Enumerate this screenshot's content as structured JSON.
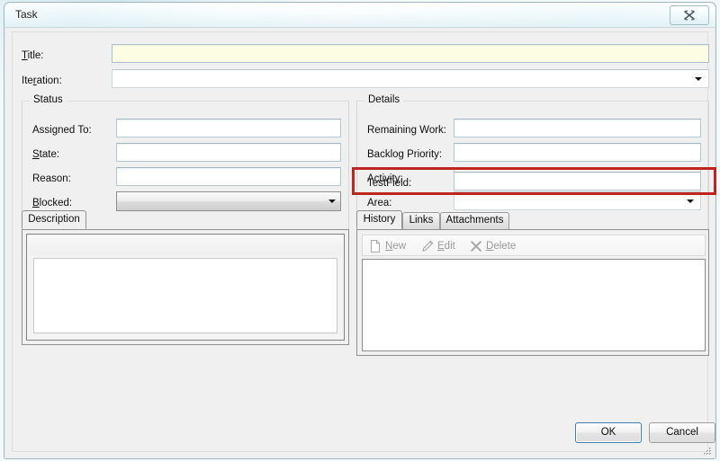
{
  "window": {
    "title": "Task",
    "close_label": "Close",
    "close_icon": "close-x-icon"
  },
  "top_fields": [
    {
      "label": "T",
      "label_accel": "T",
      "label_text": "Title:",
      "pre": "",
      "accel": "T",
      "post": "itle:",
      "value": "",
      "placeholder": "",
      "control": "textbox",
      "required": true
    },
    {
      "label_text": "Iteration:",
      "pre": "Ite",
      "accel": "r",
      "post": "ation:",
      "value": "",
      "placeholder": "",
      "control": "combobox-flat",
      "required": false
    }
  ],
  "status_group": {
    "title": "Status",
    "fields": [
      {
        "label_text": "Assigned To:",
        "pre": "Assi",
        "accel": "g",
        "post": "ned To:",
        "value": "",
        "control": "textbox"
      },
      {
        "label_text": "State:",
        "pre": "",
        "accel": "S",
        "post": "tate:",
        "value": "",
        "control": "textbox"
      },
      {
        "label_text": "Reason:",
        "pre": "Reason:",
        "accel": "",
        "post": "",
        "value": "",
        "control": "textbox"
      },
      {
        "label_text": "Blocked:",
        "pre": "",
        "accel": "B",
        "post": "locked:",
        "value": "",
        "control": "combobox-list"
      }
    ]
  },
  "details_group": {
    "title": "Details",
    "fields": [
      {
        "label_text": "Remaining Work:",
        "value": "",
        "control": "textbox"
      },
      {
        "label_text": "Backlog Priority:",
        "value": "",
        "control": "textbox"
      },
      {
        "label_text": "Activity:",
        "value": "",
        "control": "textbox"
      },
      {
        "label_text": "Area:",
        "value": "",
        "control": "combobox-flat"
      },
      {
        "label_text": "TestField:",
        "value": "",
        "control": "textbox",
        "highlighted": true
      }
    ]
  },
  "description_panel": {
    "tab_label": "Description",
    "body_text": ""
  },
  "history_panel": {
    "tabs": [
      {
        "label": "History",
        "selected": true
      },
      {
        "label": "Links",
        "selected": false
      },
      {
        "label": "Attachments",
        "selected": false
      }
    ],
    "toolbar": [
      {
        "pre": "",
        "accel": "N",
        "post": "ew",
        "label": "New",
        "icon": "new-document-icon",
        "enabled": false
      },
      {
        "pre": "",
        "accel": "E",
        "post": "dit",
        "label": "Edit",
        "icon": "edit-pencil-icon",
        "enabled": false
      },
      {
        "pre": "",
        "accel": "D",
        "post": "elete",
        "label": "Delete",
        "icon": "delete-x-icon",
        "enabled": false
      }
    ],
    "list_items": []
  },
  "footer": {
    "ok_label": "OK",
    "cancel_label": "Cancel"
  },
  "annotation": {
    "highlight_color": "#c0241f",
    "target_field": "TestField:"
  },
  "colors": {
    "required_field_background": "#fdfde4",
    "dialog_background": "#f0f0f0",
    "accent_focus_border": "#3c7fb1",
    "highlight_red": "#c0241f"
  }
}
